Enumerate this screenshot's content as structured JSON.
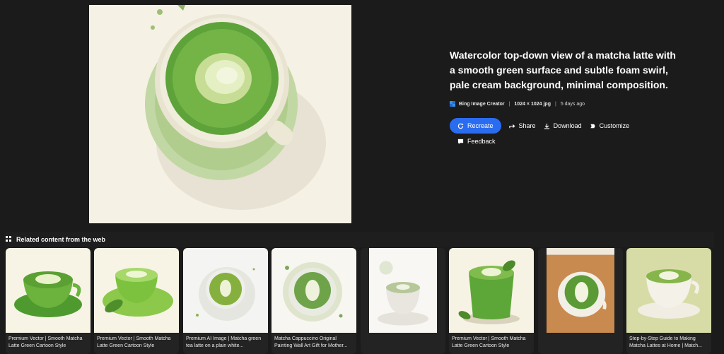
{
  "image": {
    "alt": "matcha latte watercolor",
    "colors": {
      "background": "#f5f0e4",
      "saucer": "#b9d39a",
      "cup": "#eee9d8",
      "matcha": "#5ea33a",
      "foam": "#e8f0c8"
    }
  },
  "details": {
    "title": "Watercolor top-down view of a matcha latte with a smooth green surface and subtle foam swirl, pale cream background, minimal composition.",
    "source": "Bing Image Creator",
    "dimensions": "1024 × 1024 jpg",
    "age": "5 days ago"
  },
  "actions": {
    "recreate": "Recreate",
    "share": "Share",
    "download": "Download",
    "customize": "Customize",
    "feedback": "Feedback"
  },
  "related": {
    "heading": "Related content from the web",
    "items": [
      {
        "caption": "Premium Vector | Smooth Matcha Latte Green Cartoon Style"
      },
      {
        "caption": "Premium Vector | Smooth Matcha Latte Green Cartoon Style"
      },
      {
        "caption": "Premium AI Image | Matcha green tea latte on a plain white..."
      },
      {
        "caption": "Matcha Cappuccino Original Painting Wall Art Gift for Mother..."
      },
      {
        "caption": ""
      },
      {
        "caption": "Premium Vector | Smooth Matcha Latte Green Cartoon Style"
      },
      {
        "caption": ""
      },
      {
        "caption": "Step-by-Step Guide to Making Matcha Lattes at Home | Match..."
      }
    ]
  },
  "theme": {
    "accent": "#2a6cf0",
    "background": "#1b1b1b"
  }
}
